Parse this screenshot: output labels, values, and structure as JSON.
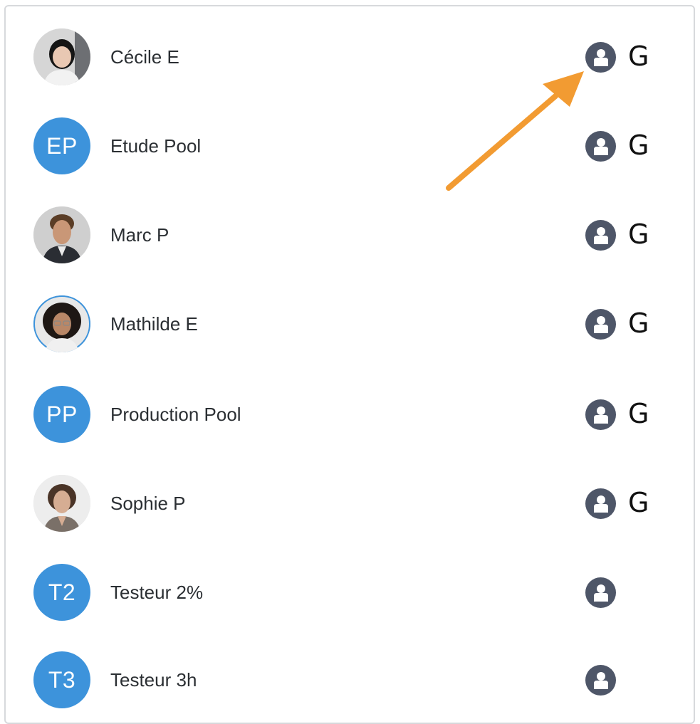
{
  "members": [
    {
      "name": "Cécile E",
      "avatar_type": "photo",
      "avatar_desc": "woman-short-dark-hair",
      "badge": "G"
    },
    {
      "name": "Etude Pool",
      "avatar_type": "initials",
      "initials": "EP",
      "badge": "G"
    },
    {
      "name": "Marc P",
      "avatar_type": "photo",
      "avatar_desc": "man-suit",
      "badge": "G"
    },
    {
      "name": "Mathilde E",
      "avatar_type": "photo",
      "avatar_desc": "woman-curly-hair-glasses",
      "badge": "G"
    },
    {
      "name": "Production Pool",
      "avatar_type": "initials",
      "initials": "PP",
      "badge": "G"
    },
    {
      "name": "Sophie P",
      "avatar_type": "photo",
      "avatar_desc": "woman-short-brown-hair",
      "badge": "G"
    },
    {
      "name": "Testeur 2%",
      "avatar_type": "initials",
      "initials": "T2",
      "badge": ""
    },
    {
      "name": "Testeur 3h",
      "avatar_type": "initials",
      "initials": "T3",
      "badge": ""
    }
  ],
  "role_icon": "user-role-icon",
  "colors": {
    "avatar_blue": "#3d93db",
    "role_icon_bg": "#4e5668",
    "arrow_orange": "#f29b32",
    "text": "#2b2f33"
  }
}
